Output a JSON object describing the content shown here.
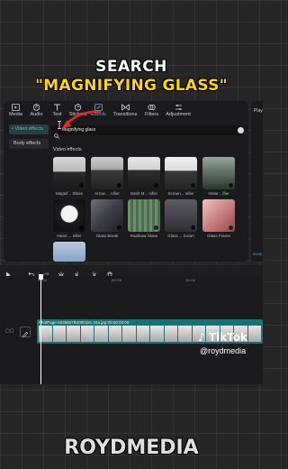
{
  "headline": {
    "line1": "SEARCH",
    "line2": "\"MAGNIFYING GLASS\""
  },
  "tabs": [
    {
      "label": "Media",
      "icon": "media-icon"
    },
    {
      "label": "Audio",
      "icon": "audio-icon"
    },
    {
      "label": "Text",
      "icon": "text-icon"
    },
    {
      "label": "Stickers",
      "icon": "stickers-icon"
    },
    {
      "label": "Effects",
      "icon": "effects-icon",
      "active": true
    },
    {
      "label": "Transitions",
      "icon": "transitions-icon"
    },
    {
      "label": "Filters",
      "icon": "filters-icon"
    },
    {
      "label": "Adjustment",
      "icon": "adjustment-icon"
    }
  ],
  "sidebar": {
    "items": [
      {
        "label": "• Video effects",
        "active": true
      },
      {
        "label": "Body effects"
      }
    ]
  },
  "search": {
    "value": "Magnifying glass"
  },
  "section_title": "Video effects",
  "effects": [
    {
      "name": "Magnif... Glass"
    },
    {
      "name": "Arrow ... nifier"
    },
    {
      "name": "Dash M... nifier"
    },
    {
      "name": "Screen... nifier"
    },
    {
      "name": "Instar... ifier"
    },
    {
      "name": "Heart ... nifier"
    },
    {
      "name": "Glass Break"
    },
    {
      "name": "Rainbow Glass"
    },
    {
      "name": "Glass ... lusion"
    },
    {
      "name": "Glass Frame"
    },
    {
      "name": ""
    }
  ],
  "side_panel": {
    "label": "Play",
    "time": "00:00"
  },
  "ruler": {
    "ticks": [
      "00:00",
      "|00:00",
      "|00:00"
    ]
  },
  "track": {
    "label": "PhotPage-5025607B4000151 24a.jpg  00:00:03:00"
  },
  "watermark": {
    "platform": "TikTok",
    "handle": "@roydmedia"
  },
  "brand": "ROYDMEDIA",
  "colors": {
    "accent": "#3fc7d4",
    "headline_yellow": "#ffd21f",
    "arrow_red": "#e0282e",
    "track": "#1f6f74"
  }
}
